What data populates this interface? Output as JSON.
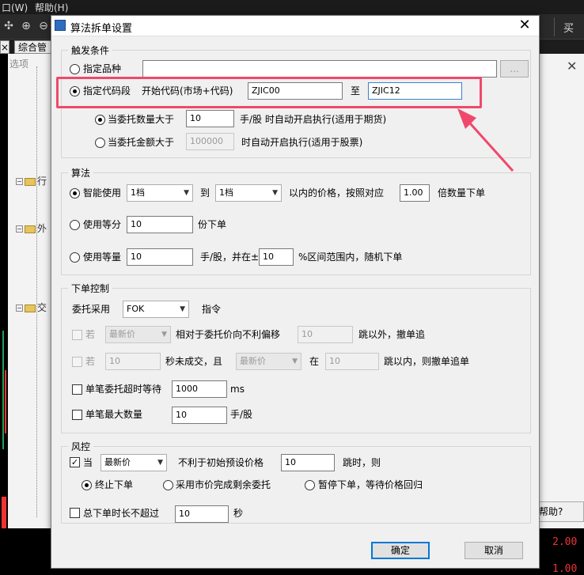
{
  "background": {
    "menu": [
      "口(W)",
      "帮助(H)"
    ],
    "tab_label": "综合管",
    "right_label": "买",
    "panel_label": "选项",
    "tree_folders": [
      "行",
      "外",
      "交"
    ],
    "help_button": "帮助?",
    "prices": [
      "2.00",
      "1.00"
    ]
  },
  "dialog": {
    "title": "算法拆单设置",
    "trigger": {
      "title": "触发条件",
      "specified_label": "指定品种",
      "browse_label": "...",
      "code_range_label": "指定代码段",
      "start_code_label": "开始代码(市场+代码)",
      "start_code": "ZJIC00",
      "to_label": "至",
      "end_code": "ZJIC12",
      "qty_label": "当委托数量大于",
      "qty_value": "10",
      "qty_suffix": "手/股 时自动开启执行(适用于期货)",
      "amt_label": "当委托金额大于",
      "amt_value": "100000",
      "amt_suffix": "时自动开启执行(适用于股票)"
    },
    "algo": {
      "title": "算法",
      "smart_label": "智能使用",
      "smart_from": "1档",
      "to_label": "到",
      "smart_to": "1档",
      "price_text": "以内的价格，按照对应",
      "multiplier": "1.00",
      "multiplier_suffix": "倍数量下单",
      "equal_parts_label": "使用等分",
      "equal_parts_value": "10",
      "equal_parts_suffix": "份下单",
      "equal_qty_label": "使用等量",
      "equal_qty_value": "10",
      "equal_qty_mid": "手/股，并在±",
      "range_value": "10",
      "range_suffix": "%区间范围内，随机下单"
    },
    "order_control": {
      "title": "下单控制",
      "entrust_label": "委托采用",
      "entrust_type": "FOK",
      "instruction_label": "指令",
      "if1_label": "若",
      "if1_price": "最新价",
      "if1_text": "相对于委托价向不利偏移",
      "if1_value": "10",
      "if1_suffix": "跳以外，撤单追",
      "if2_label": "若",
      "if2_value": "10",
      "if2_text": "秒未成交，且",
      "if2_price": "最新价",
      "if2_in": "在",
      "if2_ticks": "10",
      "if2_suffix": "跳以内，则撤单追单",
      "timeout_label": "单笔委托超时等待",
      "timeout_value": "1000",
      "timeout_unit": "ms",
      "maxqty_label": "单笔最大数量",
      "maxqty_value": "10",
      "maxqty_unit": "手/股"
    },
    "risk": {
      "title": "风控",
      "when_label": "当",
      "when_price": "最新价",
      "when_text": "不利于初始预设价格",
      "when_value": "10",
      "when_suffix": "跳时，则",
      "opt_stop": "终止下单",
      "opt_market": "采用市价完成剩余委托",
      "opt_pause": "暂停下单，等待价格回归",
      "total_label": "总下单时长不超过",
      "total_value": "10",
      "total_unit": "秒"
    },
    "ok_label": "确定",
    "cancel_label": "取消"
  }
}
